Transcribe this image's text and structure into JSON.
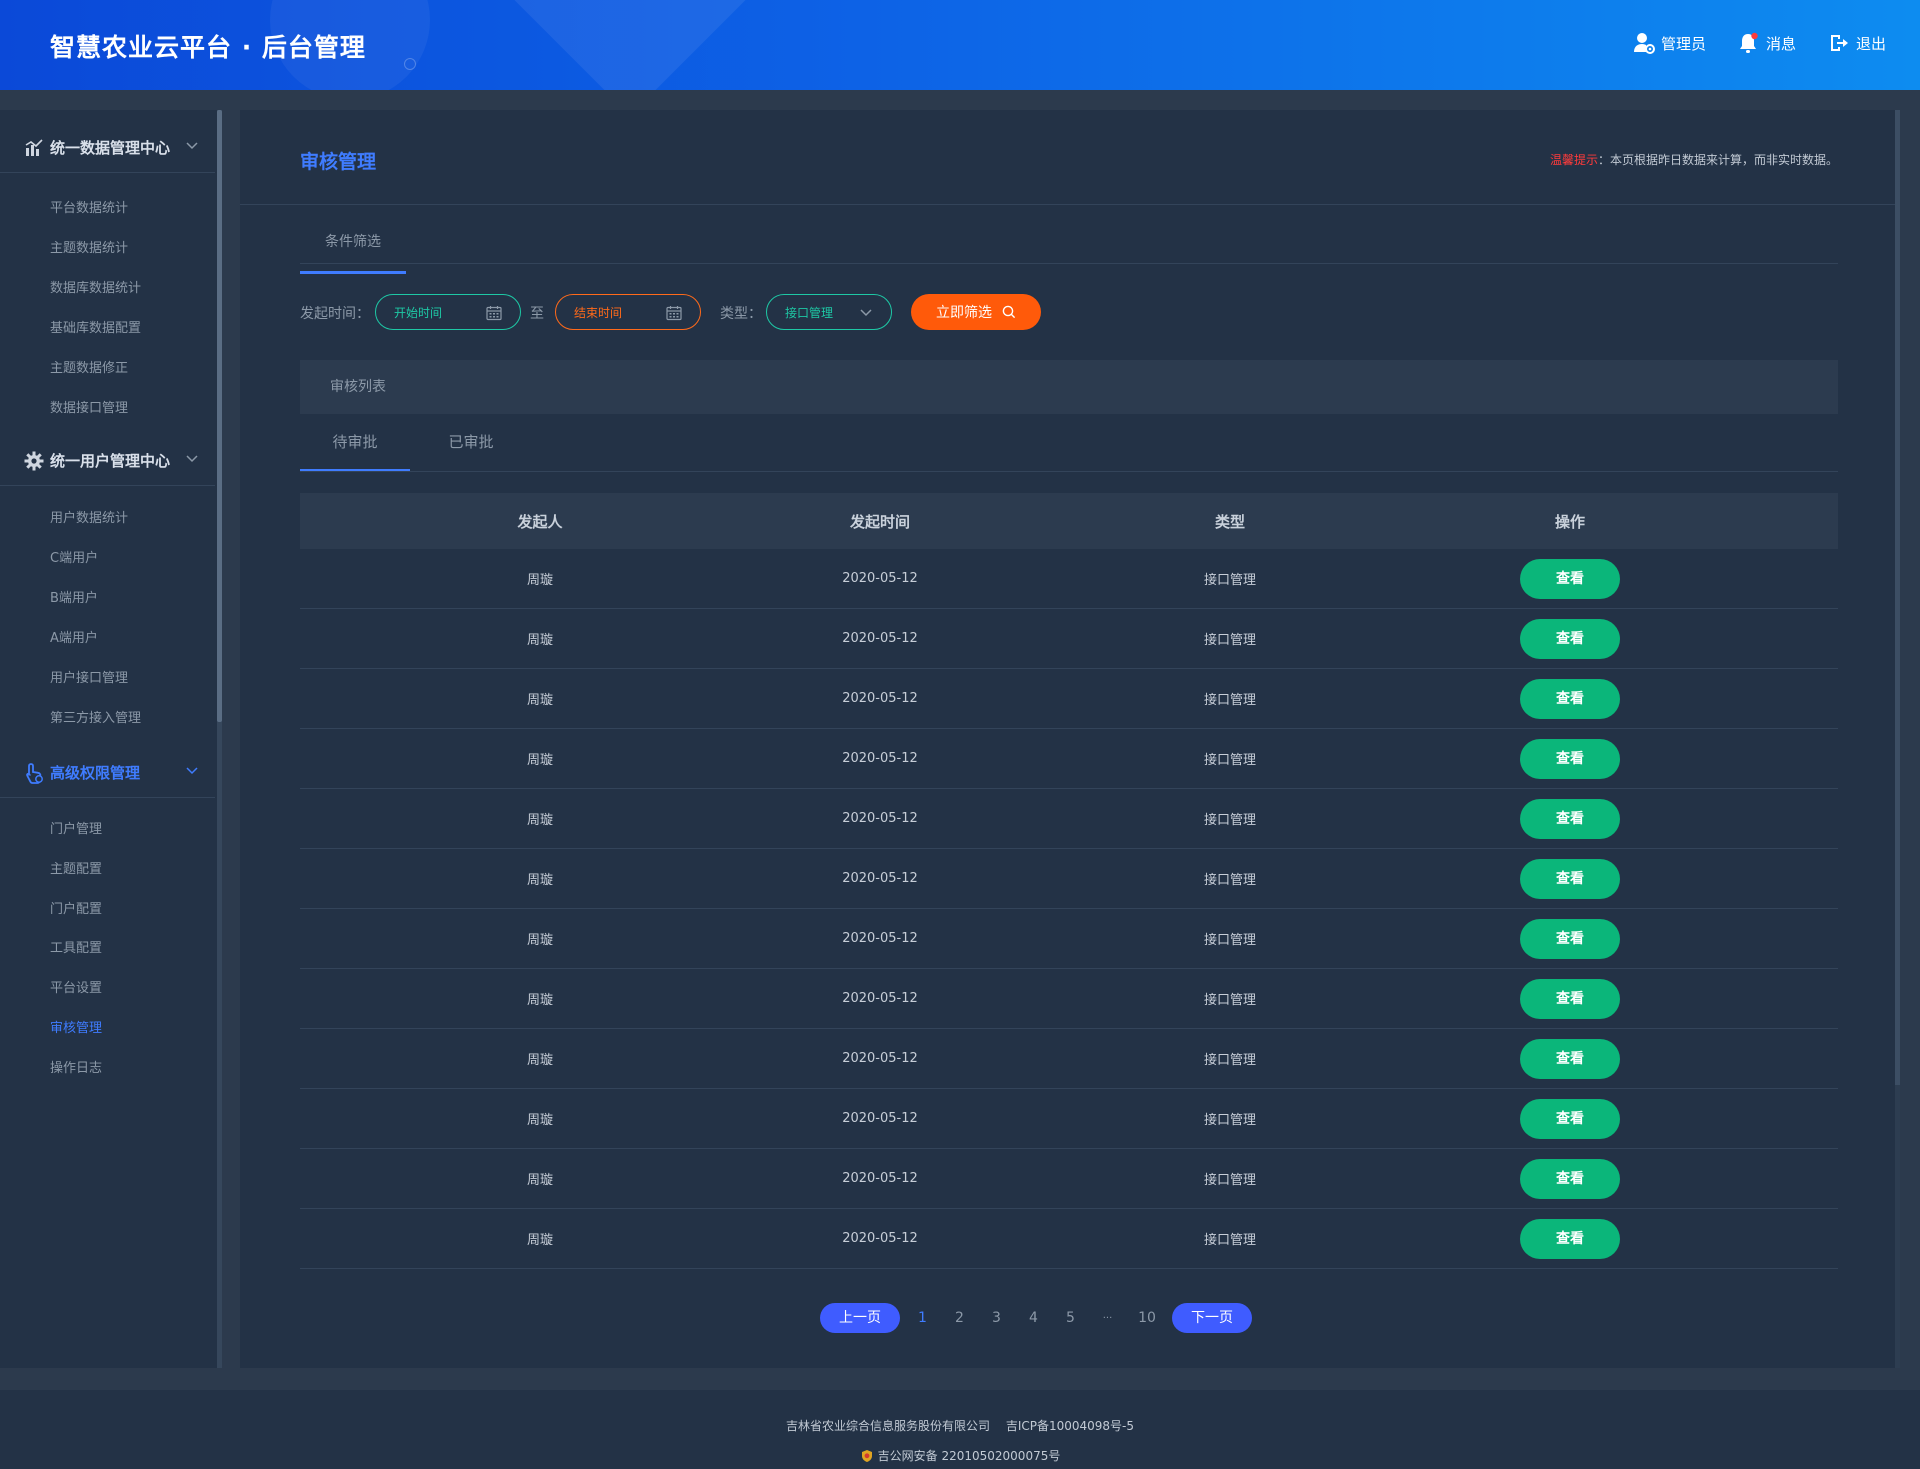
{
  "header": {
    "title": "智慧农业云平台 · 后台管理",
    "admin_label": "管理员",
    "message_label": "消息",
    "logout_label": "退出"
  },
  "sidebar": {
    "groups": [
      {
        "label": "统一数据管理中心",
        "icon": "chart-icon",
        "items": [
          "平台数据统计",
          "主题数据统计",
          "数据库数据统计",
          "基础库数据配置",
          "主题数据修正",
          "数据接口管理"
        ]
      },
      {
        "label": "统一用户管理中心",
        "icon": "gear-icon",
        "items": [
          "用户数据统计",
          "C端用户",
          "B端用户",
          "A端用户",
          "用户接口管理",
          "第三方接入管理"
        ]
      },
      {
        "label": "高级权限管理",
        "icon": "pointer-icon",
        "active": true,
        "items": [
          "门户管理",
          "主题配置",
          "门户配置",
          "工具配置",
          "平台设置",
          "审核管理",
          "操作日志"
        ],
        "active_item": "审核管理"
      }
    ]
  },
  "main": {
    "page_title": "审核管理",
    "notice_label": "温馨提示",
    "notice_text": "：本页根据昨日数据来计算，而非实时数据。",
    "filter_tab": "条件筛选",
    "filter": {
      "time_label": "发起时间：",
      "start_placeholder": "开始时间",
      "to_label": "至",
      "end_placeholder": "结束时间",
      "type_label": "类型：",
      "type_value": "接口管理",
      "submit_label": "立即筛选"
    },
    "list_title": "审核列表",
    "list_tabs": [
      "待审批",
      "已审批"
    ],
    "table": {
      "headers": [
        "发起人",
        "发起时间",
        "类型",
        "操作"
      ],
      "view_label": "查看",
      "rows": [
        {
          "name": "周璇",
          "time": "2020-05-12",
          "type": "接口管理"
        },
        {
          "name": "周璇",
          "time": "2020-05-12",
          "type": "接口管理"
        },
        {
          "name": "周璇",
          "time": "2020-05-12",
          "type": "接口管理"
        },
        {
          "name": "周璇",
          "time": "2020-05-12",
          "type": "接口管理"
        },
        {
          "name": "周璇",
          "time": "2020-05-12",
          "type": "接口管理"
        },
        {
          "name": "周璇",
          "time": "2020-05-12",
          "type": "接口管理"
        },
        {
          "name": "周璇",
          "time": "2020-05-12",
          "type": "接口管理"
        },
        {
          "name": "周璇",
          "time": "2020-05-12",
          "type": "接口管理"
        },
        {
          "name": "周璇",
          "time": "2020-05-12",
          "type": "接口管理"
        },
        {
          "name": "周璇",
          "time": "2020-05-12",
          "type": "接口管理"
        },
        {
          "name": "周璇",
          "time": "2020-05-12",
          "type": "接口管理"
        },
        {
          "name": "周璇",
          "time": "2020-05-12",
          "type": "接口管理"
        }
      ]
    },
    "pagination": {
      "prev_label": "上一页",
      "next_label": "下一页",
      "pages": [
        "1",
        "2",
        "3",
        "4",
        "5",
        "···",
        "10"
      ],
      "current": "1"
    }
  },
  "footer": {
    "company": "吉林省农业综合信息服务股份有限公司",
    "icp": "吉ICP备10004098号-5",
    "police": "吉公网安备 22010502000075号"
  },
  "colors": {
    "accent": "#3f7cff",
    "warning": "#ff3b3b",
    "filter_button": "#ff5a0a",
    "view_button": "#0bb67a",
    "teal": "#1ec8a5"
  }
}
